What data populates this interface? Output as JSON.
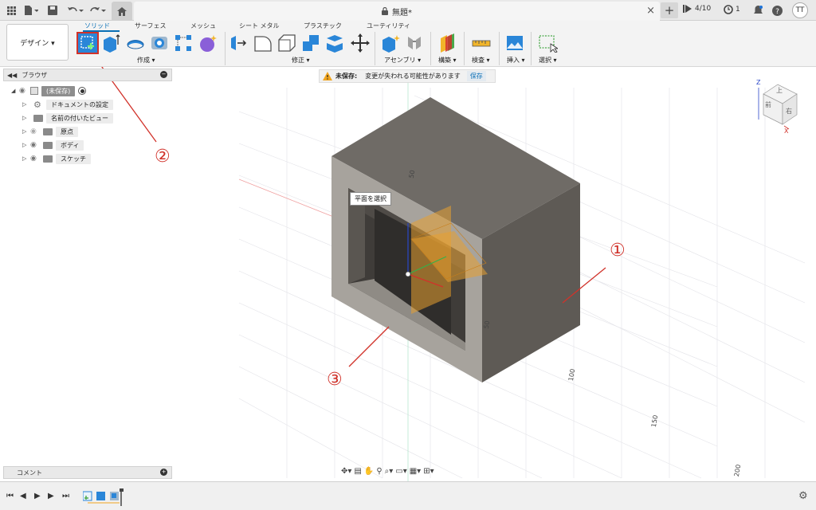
{
  "appbar": {
    "doc_title": "無題*",
    "close": "×",
    "plus": "+",
    "jobs": "4/10",
    "clock": "1",
    "user": "TT"
  },
  "toolbar": {
    "design_label": "デザイン ▾",
    "tabs": [
      {
        "label": "ソリッド",
        "active": true
      },
      {
        "label": "サーフェス",
        "active": false
      },
      {
        "label": "メッシュ",
        "active": false
      },
      {
        "label": "シート メタル",
        "active": false
      },
      {
        "label": "プラスチック",
        "active": false
      },
      {
        "label": "ユーティリティ",
        "active": false
      }
    ],
    "groups": {
      "create": "作成 ▾",
      "modify": "修正 ▾",
      "assemble": "アセンブリ ▾",
      "construct": "構築 ▾",
      "inspect": "検査 ▾",
      "insert": "挿入 ▾",
      "select": "選択 ▾"
    }
  },
  "browser": {
    "title": "ブラウザ",
    "items": [
      {
        "label": "(未保存)"
      },
      {
        "label": "ドキュメントの設定"
      },
      {
        "label": "名前の付いたビュー"
      },
      {
        "label": "原点"
      },
      {
        "label": "ボディ"
      },
      {
        "label": "スケッチ"
      }
    ]
  },
  "comments": {
    "title": "コメント"
  },
  "viewport": {
    "warning_title": "未保存:",
    "warning_text": "変更が失われる可能性があります",
    "save_label": "保存",
    "tooltip": "平面を選択",
    "callouts": [
      "①",
      "②",
      "③"
    ],
    "dims": [
      "50",
      "50",
      "100",
      "150",
      "200"
    ],
    "viewcube": {
      "top": "上",
      "front": "前",
      "right": "右",
      "z": "Z",
      "x": "X"
    },
    "colors": {
      "body": "#6b6862",
      "plane": "#e8a030",
      "callout": "#d1322a",
      "accent": "#0a6fb5"
    }
  }
}
